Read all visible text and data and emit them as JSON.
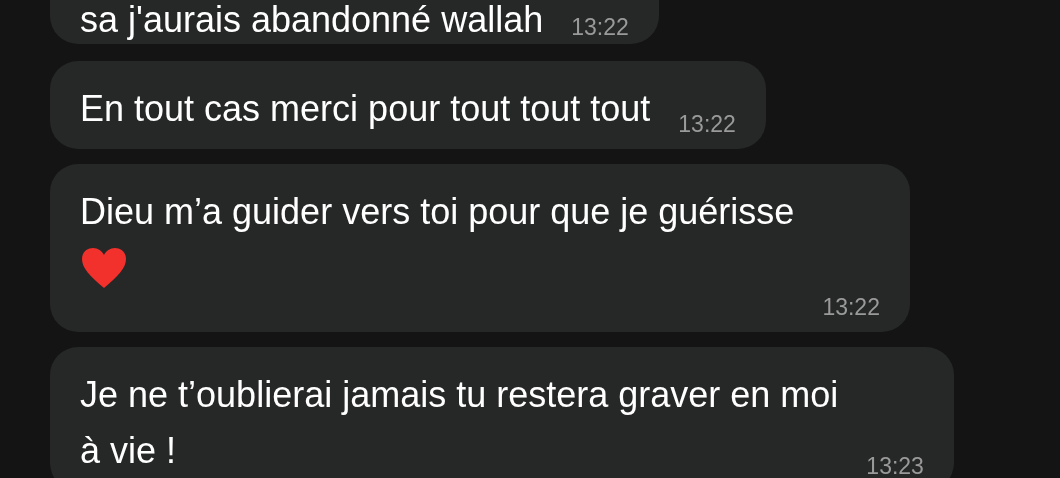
{
  "messages": [
    {
      "text": "sa j'aurais abandonné wallah",
      "time": "13:22",
      "heart": false
    },
    {
      "text": "En tout cas merci pour tout tout tout",
      "time": "13:22",
      "heart": false
    },
    {
      "text": "Dieu m’a guider vers toi pour que je guérisse",
      "time": "13:22",
      "heart": true
    },
    {
      "text": "Je ne t’oublierai jamais tu restera graver en moi\nà vie !",
      "time": "13:23",
      "heart": false
    }
  ]
}
